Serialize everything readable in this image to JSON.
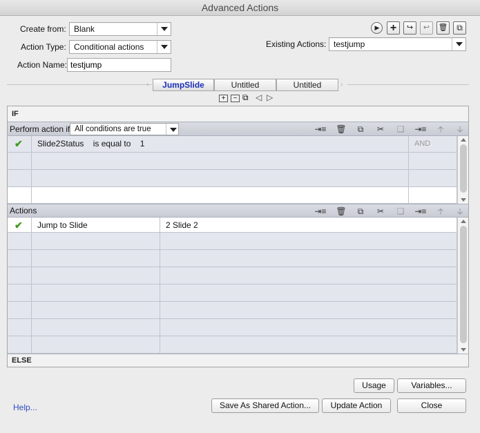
{
  "window": {
    "title": "Advanced Actions"
  },
  "form": {
    "create_from_label": "Create from:",
    "create_from_value": "Blank",
    "action_type_label": "Action Type:",
    "action_type_value": "Conditional actions",
    "action_name_label": "Action Name:",
    "action_name_value": "testjump",
    "existing_actions_label": "Existing Actions:",
    "existing_actions_value": "testjump"
  },
  "toolbar_icons": [
    "preview-icon",
    "add-icon",
    "import-icon",
    "export-icon",
    "delete-icon",
    "duplicate-icon"
  ],
  "tabs": [
    {
      "label": "JumpSlide",
      "active": true
    },
    {
      "label": "Untitled",
      "active": false
    },
    {
      "label": "Untitled",
      "active": false
    }
  ],
  "if_section": {
    "title": "IF",
    "perform_label": "Perform action if:",
    "perform_value": "All conditions are true",
    "conditions": [
      {
        "checked": true,
        "variable": "Slide2Status",
        "operator": "is equal to",
        "value": "1",
        "logic": "AND"
      }
    ]
  },
  "actions_section": {
    "title": "Actions",
    "rows": [
      {
        "checked": true,
        "action": "Jump to Slide",
        "target": "2 Slide 2"
      }
    ]
  },
  "else_section": {
    "title": "ELSE"
  },
  "footer": {
    "help": "Help...",
    "usage": "Usage",
    "variables": "Variables...",
    "save_shared": "Save As Shared Action...",
    "update": "Update Action",
    "close": "Close"
  },
  "colors": {
    "accent": "#1a2fb8",
    "check": "#3e9a1d",
    "link": "#2d4fbf"
  }
}
